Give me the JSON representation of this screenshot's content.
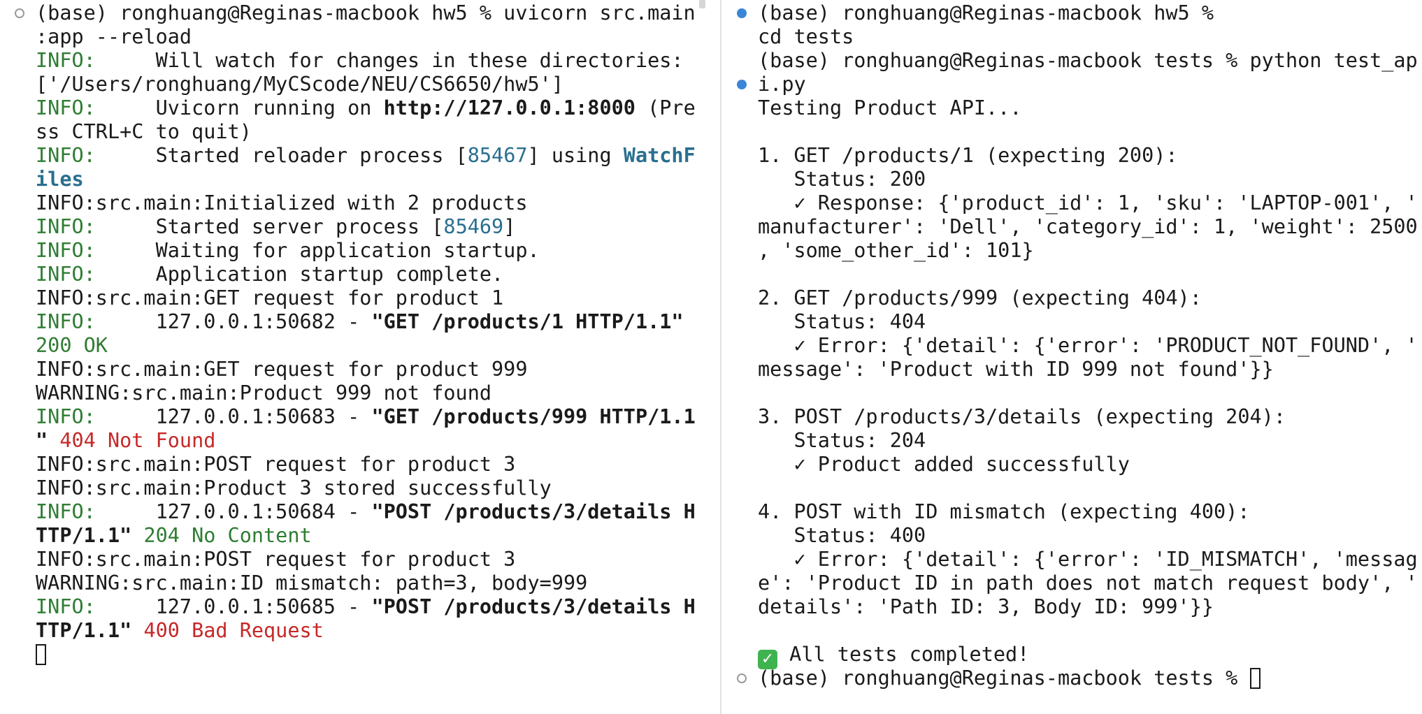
{
  "left_terminal": {
    "command_line_1": "(base) ronghuang@Reginas-macbook hw5 % uvicorn src.main",
    "command_line_2": ":app --reload",
    "info_label": "INFO:",
    "l3_text": "     Will watch for changes in these directories:",
    "l4_text": "['/Users/ronghuang/MyCScode/NEU/CS6650/hw5']",
    "l5_text": "     Uvicorn running on ",
    "l5_url": "http://127.0.0.1:8000",
    "l5_suffix": " (Pre",
    "l6_text": "ss CTRL+C to quit)",
    "l7_text": "     Started reloader process [",
    "l7_pid": "85467",
    "l7_mid": "] using ",
    "l7_tool_a": "WatchF",
    "l8_tool_b": "iles",
    "l9_text": "INFO:src.main:Initialized with 2 products",
    "l10_text": "     Started server process [",
    "l10_pid": "85469",
    "l10_end": "]",
    "l11_text": "     Waiting for application startup.",
    "l12_text": "     Application startup complete.",
    "l13_text": "INFO:src.main:GET request for product 1",
    "l14_addr": "     127.0.0.1:50682 - ",
    "l14_req": "\"GET /products/1 HTTP/1.1\"",
    "l15_status": "200 OK",
    "l16_text": "INFO:src.main:GET request for product 999",
    "l17_text": "WARNING:src.main:Product 999 not found",
    "l18_addr": "     127.0.0.1:50683 - ",
    "l18_req": "\"GET /products/999 HTTP/1.1",
    "l19_req": "\"",
    "l19_status": " 404 Not Found",
    "l20_text": "INFO:src.main:POST request for product 3",
    "l21_text": "INFO:src.main:Product 3 stored successfully",
    "l22_addr": "     127.0.0.1:50684 - ",
    "l22_req": "\"POST /products/3/details H",
    "l23_req": "TTP/1.1\"",
    "l23_status": " 204 No Content",
    "l24_text": "INFO:src.main:POST request for product 3",
    "l25_text": "WARNING:src.main:ID mismatch: path=3, body=999",
    "l26_addr": "     127.0.0.1:50685 - ",
    "l26_req": "\"POST /products/3/details H",
    "l27_req": "TTP/1.1\"",
    "l27_status": " 400 Bad Request"
  },
  "right_terminal": {
    "r1": "(base) ronghuang@Reginas-macbook hw5 %",
    "r2": "cd tests",
    "r3": "(base) ronghuang@Reginas-macbook tests % python test_ap",
    "r4": "i.py",
    "r5": "Testing Product API...",
    "r7": "1. GET /products/1 (expecting 200):",
    "r8": "   Status: 200",
    "r9": "   ✓ Response: {'product_id': 1, 'sku': 'LAPTOP-001', '",
    "r10": "manufacturer': 'Dell', 'category_id': 1, 'weight': 2500",
    "r11": ", 'some_other_id': 101}",
    "r13": "2. GET /products/999 (expecting 404):",
    "r14": "   Status: 404",
    "r15": "   ✓ Error: {'detail': {'error': 'PRODUCT_NOT_FOUND', '",
    "r16": "message': 'Product with ID 999 not found'}}",
    "r18": "3. POST /products/3/details (expecting 204):",
    "r19": "   Status: 204",
    "r20": "   ✓ Product added successfully",
    "r22": "4. POST with ID mismatch (expecting 400):",
    "r23": "   Status: 400",
    "r24": "   ✓ Error: {'detail': {'error': 'ID_MISMATCH', 'messag",
    "r25": "e': 'Product ID in path does not match request body', '",
    "r26": "details': 'Path ID: 3, Body ID: 999'}}",
    "r28_emoji": "✓",
    "r28_text": " All tests completed!",
    "r29": "(base) ronghuang@Reginas-macbook tests % "
  },
  "colors": {
    "info_green": "#2e7d32",
    "error_red": "#c62828",
    "pid_teal": "#2a6f8f",
    "marker_blue": "#3a86d8",
    "marker_gray": "#9a9a9a"
  }
}
